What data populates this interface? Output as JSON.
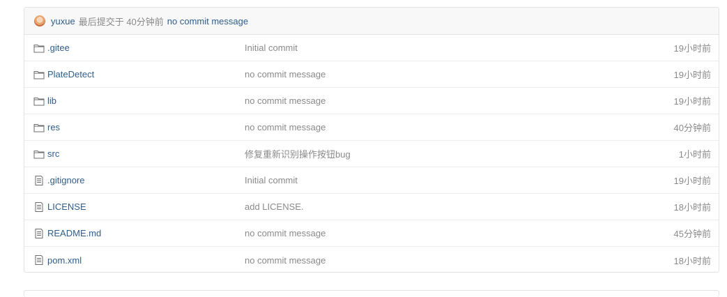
{
  "commit": {
    "author": "yuxue",
    "meta": "最后提交于 40分钟前",
    "message": "no commit message"
  },
  "files": [
    {
      "name": ".gitee",
      "type": "folder",
      "message": "Initial commit",
      "time": "19小时前"
    },
    {
      "name": "PlateDetect",
      "type": "folder",
      "message": "no commit message",
      "time": "19小时前"
    },
    {
      "name": "lib",
      "type": "folder",
      "message": "no commit message",
      "time": "19小时前"
    },
    {
      "name": "res",
      "type": "folder",
      "message": "no commit message",
      "time": "40分钟前"
    },
    {
      "name": "src",
      "type": "folder",
      "message": "修复重新识别操作按钮bug",
      "time": "1小时前"
    },
    {
      "name": ".gitignore",
      "type": "file",
      "message": "Initial commit",
      "time": "19小时前"
    },
    {
      "name": "LICENSE",
      "type": "file",
      "message": "add LICENSE.",
      "time": "18小时前"
    },
    {
      "name": "README.md",
      "type": "file",
      "message": "no commit message",
      "time": "45分钟前"
    },
    {
      "name": "pom.xml",
      "type": "file",
      "message": "no commit message",
      "time": "18小时前"
    }
  ],
  "icons": {
    "folder": "folder-icon",
    "file": "file-icon"
  },
  "colors": {
    "link": "#2f5d8a",
    "muted": "#8a8a8a",
    "border": "#e3e3e3",
    "header_bg": "#f8f8f8"
  }
}
